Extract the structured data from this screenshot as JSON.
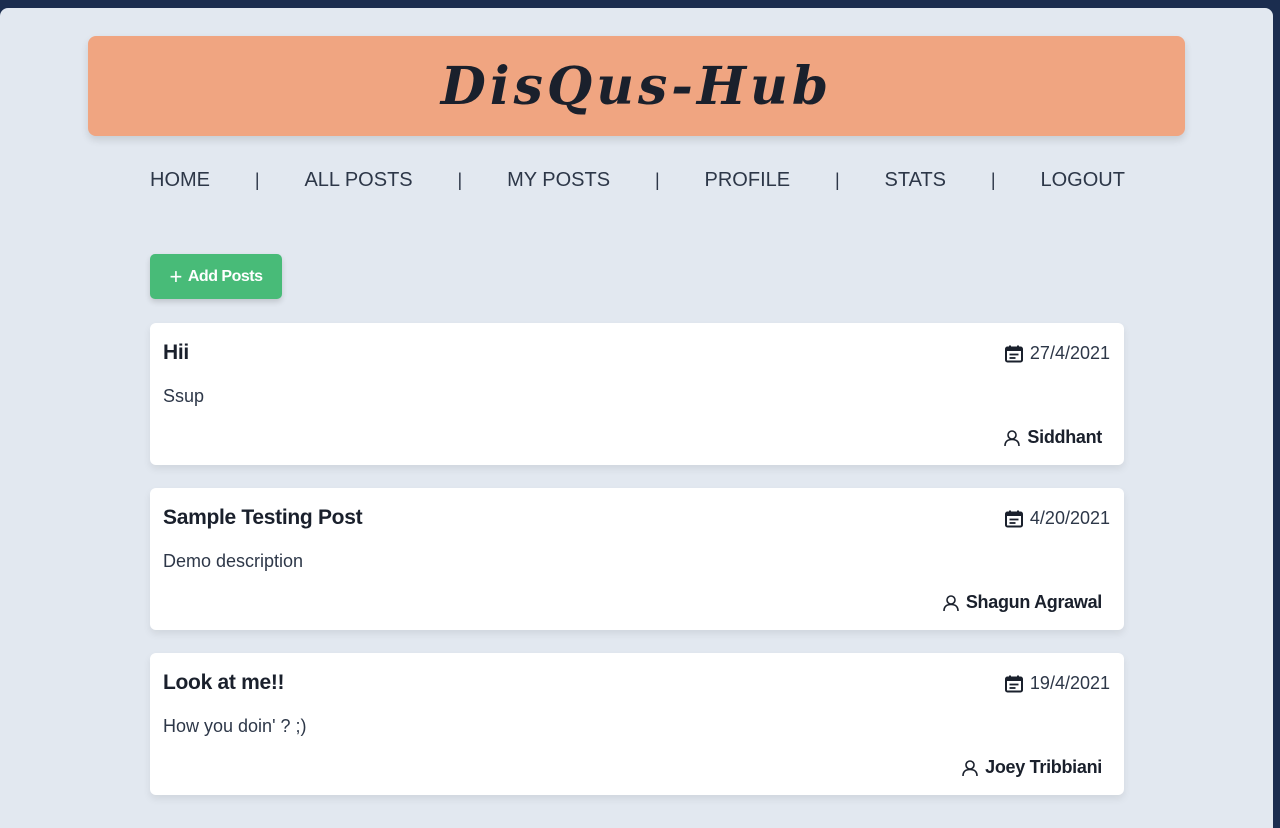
{
  "header": {
    "brand": "DisQus-Hub"
  },
  "nav": {
    "items": [
      "HOME",
      "ALL POSTS",
      "MY POSTS",
      "PROFILE",
      "STATS",
      "LOGOUT"
    ],
    "separator": "|"
  },
  "actions": {
    "add_label": "Add Posts",
    "add_icon": "plus-icon"
  },
  "posts": [
    {
      "title": "Hii",
      "date": "27/4/2021",
      "description": "Ssup",
      "author": "Siddhant"
    },
    {
      "title": "Sample Testing Post",
      "date": "4/20/2021",
      "description": "Demo description",
      "author": "Shagun Agrawal"
    },
    {
      "title": "Look at me!!",
      "date": "19/4/2021",
      "description": "How you doin' ? ;)",
      "author": "Joey Tribbiani"
    }
  ],
  "colors": {
    "header_bg": "#f0a581",
    "page_bg": "#e2e8f0",
    "frame_bg": "#1b2d4f",
    "button_bg": "#48bb78"
  }
}
